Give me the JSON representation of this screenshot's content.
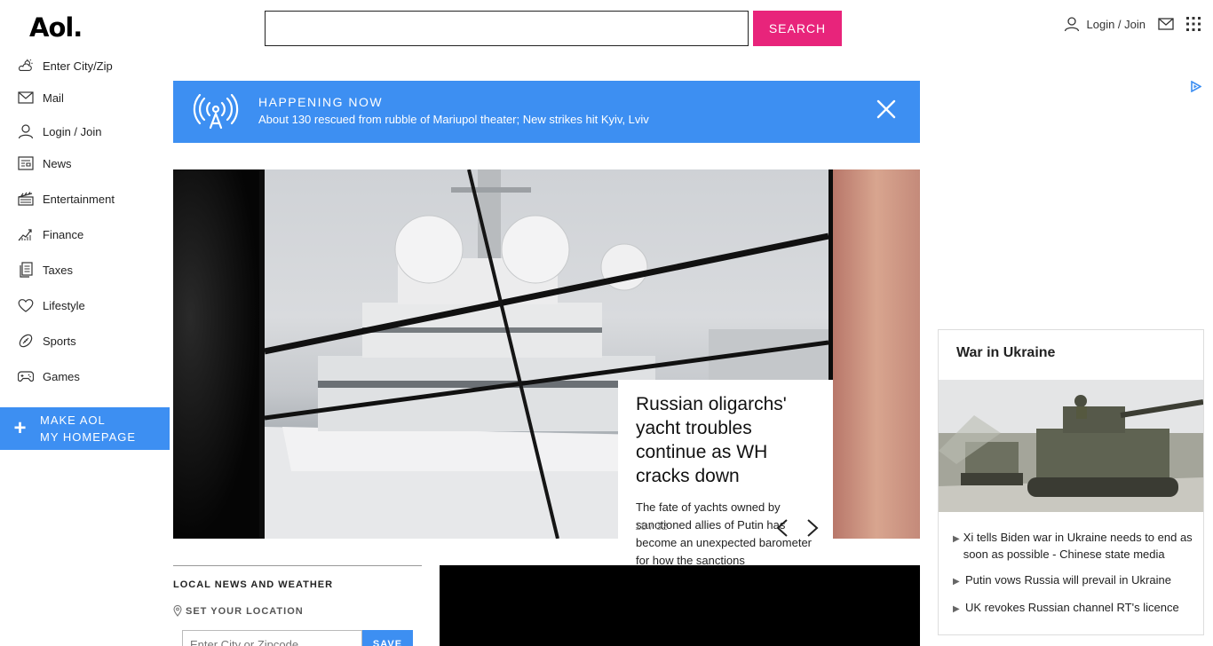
{
  "logo": "Aol.",
  "search": {
    "placeholder": "",
    "button": "SEARCH"
  },
  "header": {
    "login": "Login / Join"
  },
  "sidebar": {
    "items": [
      {
        "label": "Enter City/Zip"
      },
      {
        "label": "Mail"
      },
      {
        "label": "Login / Join"
      },
      {
        "label": "News"
      },
      {
        "label": "Entertainment"
      },
      {
        "label": "Finance"
      },
      {
        "label": "Taxes"
      },
      {
        "label": "Lifestyle"
      },
      {
        "label": "Sports"
      },
      {
        "label": "Games"
      }
    ],
    "homepage_line1": "MAKE AOL",
    "homepage_line2": "MY HOMEPAGE"
  },
  "happening": {
    "label": "HAPPENING NOW",
    "text": "About 130 rescued from rubble of Mariupol theater; New strikes hit Kyiv, Lviv"
  },
  "carousel": {
    "title": "Russian oligarchs' yacht troubles continue as WH cracks down",
    "description": "The fate of yachts owned by sanctioned allies of Putin has become an unexpected barometer for how the sanctions",
    "counter": "18 / 32"
  },
  "local": {
    "title": "LOCAL NEWS AND WEATHER",
    "set_location": "SET YOUR LOCATION",
    "zip_placeholder": "Enter City or Zipcode",
    "save": "SAVE"
  },
  "war": {
    "title": "War in Ukraine",
    "items": [
      "Xi tells Biden war in Ukraine needs to end as soon as possible - Chinese state media",
      "Putin vows Russia will prevail in Ukraine",
      "UK revokes Russian channel RT's licence"
    ]
  },
  "colors": {
    "accent_pink": "#e8247b",
    "accent_blue": "#3d8ff2"
  }
}
